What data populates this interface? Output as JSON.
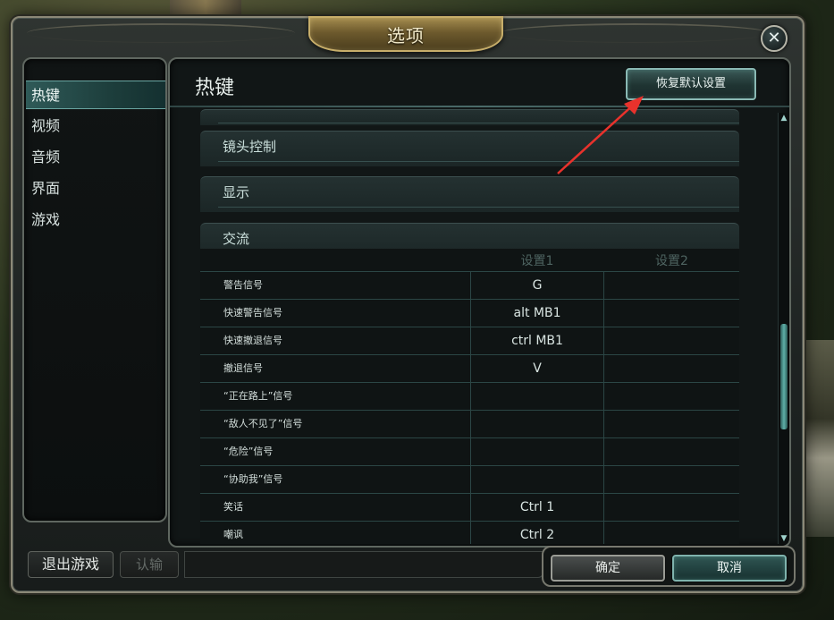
{
  "window": {
    "title": "选项",
    "close_icon": "close-icon"
  },
  "sidebar": {
    "items": [
      {
        "label": "热键",
        "active": true
      },
      {
        "label": "视频",
        "active": false
      },
      {
        "label": "音频",
        "active": false
      },
      {
        "label": "界面",
        "active": false
      },
      {
        "label": "游戏",
        "active": false
      }
    ]
  },
  "content": {
    "title": "热键",
    "reset_button": "恢复默认设置",
    "groups": [
      {
        "label": ""
      },
      {
        "label": "镜头控制"
      },
      {
        "label": "显示"
      },
      {
        "label": "交流"
      }
    ],
    "table": {
      "headers": [
        "设置1",
        "设置2"
      ],
      "rows": [
        {
          "label": "警告信号",
          "key1": "G",
          "key2": ""
        },
        {
          "label": "快速警告信号",
          "key1": "alt  MB1",
          "key2": ""
        },
        {
          "label": "快速撤退信号",
          "key1": "ctrl  MB1",
          "key2": ""
        },
        {
          "label": "撤退信号",
          "key1": "V",
          "key2": ""
        },
        {
          "label": "“正在路上”信号",
          "key1": "",
          "key2": ""
        },
        {
          "label": "“敌人不见了”信号",
          "key1": "",
          "key2": ""
        },
        {
          "label": "“危险”信号",
          "key1": "",
          "key2": ""
        },
        {
          "label": "“协助我”信号",
          "key1": "",
          "key2": ""
        },
        {
          "label": "笑话",
          "key1": "Ctrl  1",
          "key2": ""
        },
        {
          "label": "嘲讽",
          "key1": "Ctrl  2",
          "key2": ""
        }
      ]
    }
  },
  "footer": {
    "exit_game": "退出游戏",
    "surrender": "认输",
    "ok": "确定",
    "cancel": "取消"
  },
  "colors": {
    "accent": "#7fb3ad",
    "annotation_arrow": "#e8322c"
  }
}
